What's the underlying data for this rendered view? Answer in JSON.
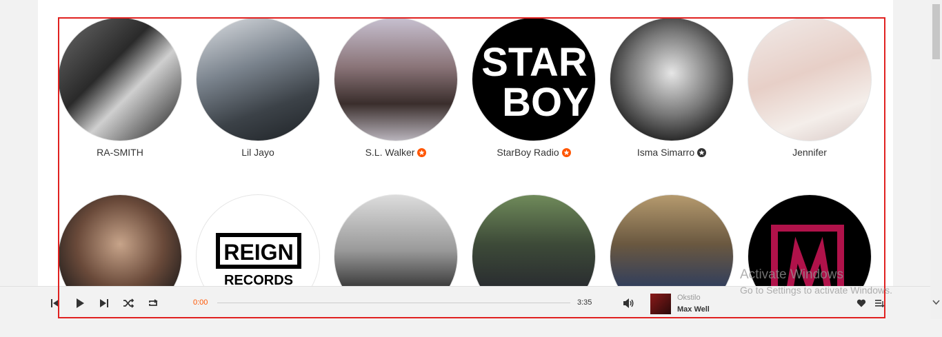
{
  "artists": [
    {
      "name": "RA-SMITH",
      "badge": "none"
    },
    {
      "name": "Lil Jayo",
      "badge": "none"
    },
    {
      "name": "S.L. Walker",
      "badge": "pro-star"
    },
    {
      "name": "StarBoy Radio",
      "badge": "pro-star"
    },
    {
      "name": "Isma Simarro",
      "badge": "pro-star-dark"
    },
    {
      "name": "Jennifer",
      "badge": "none"
    },
    {
      "name": "",
      "badge": "none"
    },
    {
      "name": "",
      "badge": "none"
    },
    {
      "name": "",
      "badge": "none"
    },
    {
      "name": "",
      "badge": "none"
    },
    {
      "name": "",
      "badge": "none"
    },
    {
      "name": "",
      "badge": "none"
    }
  ],
  "avatar_text": {
    "starboy_line1": "STAR",
    "starboy_line2": "BOY",
    "reign_line1": "REIGN",
    "reign_line2": "RECORDS"
  },
  "player": {
    "current_time": "0:00",
    "total_time": "3:35",
    "artist": "Okstilo",
    "track": "Max Well",
    "progress": 0
  },
  "watermark": {
    "line1": "Activate Windows",
    "line2": "Go to Settings to activate Windows."
  },
  "colors": {
    "accent": "#ff5500",
    "selection_border": "#e0201f"
  },
  "icons": {
    "skip_back": "skip-back-icon",
    "play": "play-icon",
    "skip_forward": "skip-forward-icon",
    "shuffle": "shuffle-icon",
    "repeat": "repeat-icon",
    "volume": "volume-icon",
    "like": "heart-icon",
    "queue": "queue-icon"
  }
}
